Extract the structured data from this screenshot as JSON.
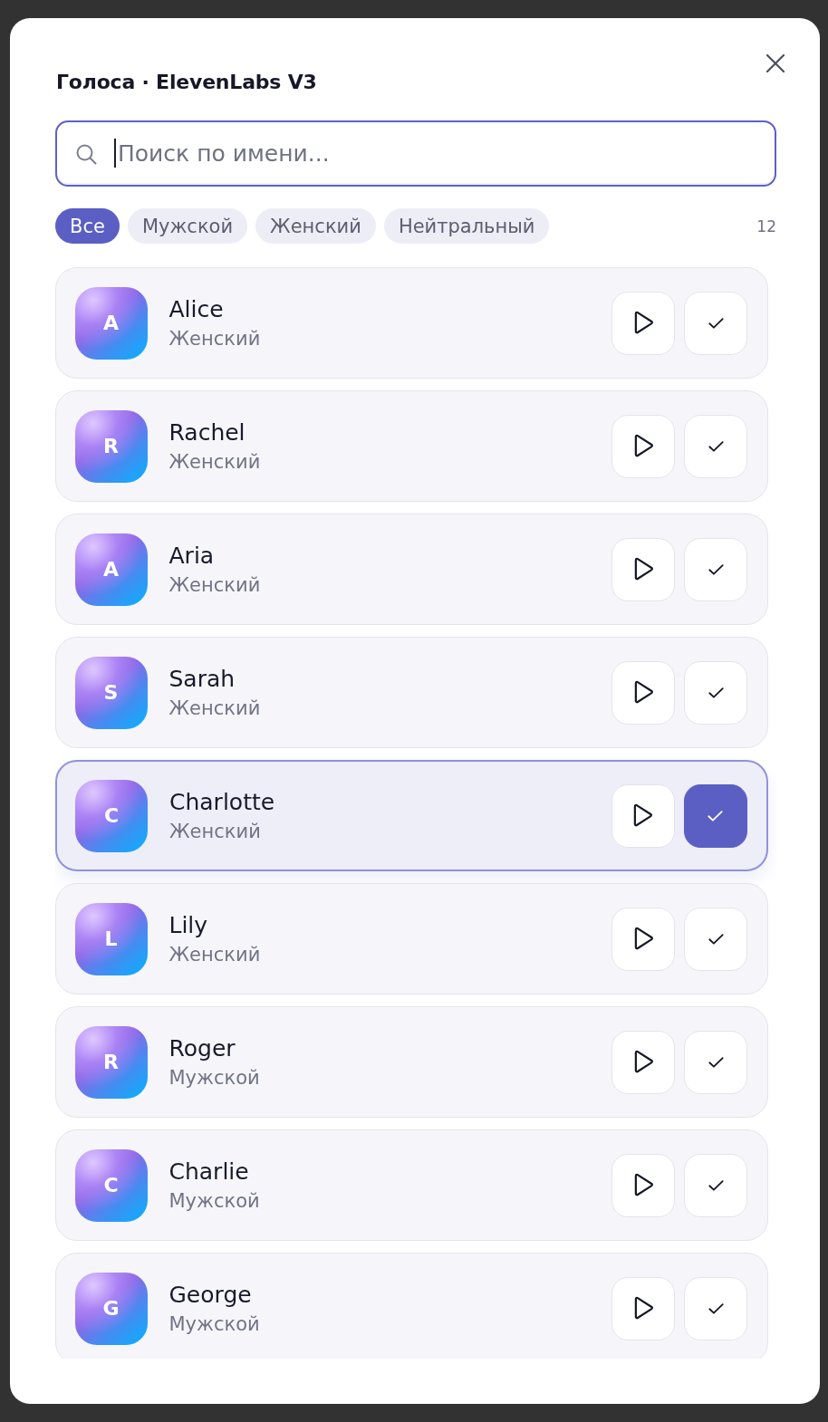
{
  "dialog": {
    "title": "Голоса · ElevenLabs V3"
  },
  "search": {
    "placeholder": "Поиск по имени...",
    "focused": true
  },
  "filters": [
    {
      "label": "Все",
      "selected": true
    },
    {
      "label": "Мужской",
      "selected": false
    },
    {
      "label": "Женский",
      "selected": false
    },
    {
      "label": "Нейтральный",
      "selected": false
    }
  ],
  "count": "12",
  "voices": [
    {
      "initial": "A",
      "name": "Alice",
      "gender": "Женский",
      "selected": false
    },
    {
      "initial": "R",
      "name": "Rachel",
      "gender": "Женский",
      "selected": false
    },
    {
      "initial": "A",
      "name": "Aria",
      "gender": "Женский",
      "selected": false
    },
    {
      "initial": "S",
      "name": "Sarah",
      "gender": "Женский",
      "selected": false
    },
    {
      "initial": "C",
      "name": "Charlotte",
      "gender": "Женский",
      "selected": true
    },
    {
      "initial": "L",
      "name": "Lily",
      "gender": "Женский",
      "selected": false
    },
    {
      "initial": "R",
      "name": "Roger",
      "gender": "Мужской",
      "selected": false
    },
    {
      "initial": "C",
      "name": "Charlie",
      "gender": "Мужской",
      "selected": false
    },
    {
      "initial": "G",
      "name": "George",
      "gender": "Мужской",
      "selected": false
    }
  ]
}
